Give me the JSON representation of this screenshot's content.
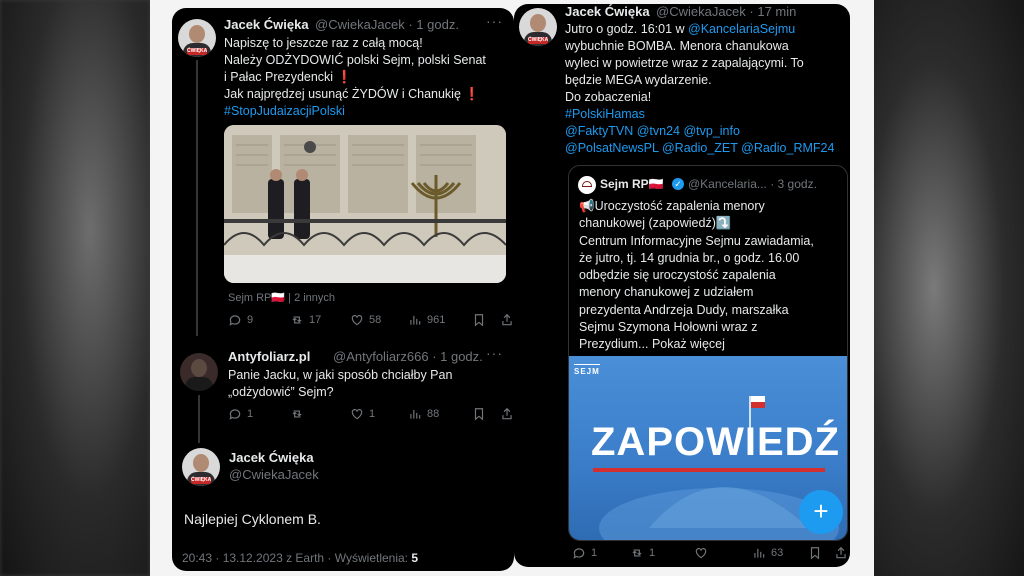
{
  "colors": {
    "link": "#1d9bf0",
    "muted": "#71767b",
    "text": "#e7e9ea",
    "panel": "#000000",
    "accent_red": "#c62828"
  },
  "left": {
    "tweet1": {
      "author": "Jacek Ćwięka",
      "handle_time": "@CwiekaJacek · 1 godz.",
      "lines": [
        "Napiszę to jeszcze raz z całą mocą!",
        "Należy ODŻYDOWIĆ polski Sejm, polski Senat",
        "i Pałac Prezydencki ❗",
        "Jak najprędzej usunąć ŻYDÓW i Chanukię ❗"
      ],
      "hashtag": "#StopJudaizacjiPolski",
      "media_caption": "Sejm RP🇵🇱 | 2 innych",
      "stats": {
        "replies": "9",
        "retweets": "17",
        "likes": "58",
        "views": "961"
      }
    },
    "tweet2": {
      "author": "Antyfoliarz.pl",
      "handle_time": "@Antyfoliarz666 · 1 godz.",
      "lines": [
        "Panie Jacku, w jaki sposób chciałby Pan",
        "„odżydowić” Sejm?"
      ],
      "stats": {
        "replies": "1",
        "retweets": "",
        "likes": "1",
        "views": "88"
      }
    },
    "tweet3": {
      "author": "Jacek Ćwięka",
      "handle": "@CwiekaJacek",
      "body": "Najlepiej Cyklonem B.",
      "footer_prefix": "20:43 · 13.12.2023 z Earth · Wyświetlenia: ",
      "footer_views": "5"
    }
  },
  "right": {
    "tweet": {
      "author": "Jacek Ćwięka",
      "handle_time": "@CwiekaJacek · 17 min",
      "line1_prefix": "Jutro o godz. 16:01 w ",
      "line1_mention": "@KancelariaSejmu",
      "lines": [
        "wybuchnie BOMBA. Menora chanukowa",
        "wyleci w powietrze wraz z zapalającymi. To",
        "będzie MEGA wydarzenie.",
        "Do zobaczenia!"
      ],
      "link_lines": [
        "#PolskiHamas",
        "@FaktyTVN @tvn24 @tvp_info",
        "@PolsatNewsPL @Radio_ZET @Radio_RMF24"
      ],
      "stats": {
        "replies": "1",
        "retweets": "1",
        "likes": "",
        "views": "63"
      }
    },
    "quote": {
      "author": "Sejm RP🇵🇱",
      "handle_time": "@Kancelaria... · 3 godz.",
      "lines": [
        "📢Uroczystość zapalenia menory",
        "chanukowej (zapowiedź)⤵️",
        "Centrum Informacyjne Sejmu zawiadamia,",
        "że jutro, tj. 14 grudnia br., o godz. 16.00",
        "odbędzie się uroczystość zapalenia",
        "menory chanukowej z udziałem",
        "prezydenta Andrzeja Dudy, marszałka",
        "Sejmu Szymona Hołowni wraz z"
      ],
      "last_line_prefix": "Prezydium... ",
      "show_more": "Pokaż więcej",
      "image_logo": "SEJM",
      "image_title": "ZAPOWIEDŹ",
      "fab": "+"
    }
  }
}
